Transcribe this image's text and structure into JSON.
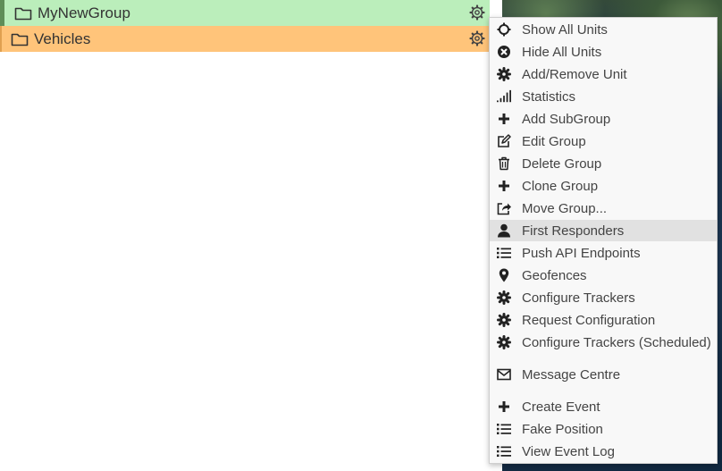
{
  "groups": [
    {
      "name": "MyNewGroup",
      "color": "#bbeebb"
    },
    {
      "name": "Vehicles",
      "color": "#ffc47a"
    }
  ],
  "context_menu": {
    "highlighted": "First Responders",
    "items": [
      {
        "label": "Show All Units",
        "icon": "crosshair-icon"
      },
      {
        "label": "Hide All Units",
        "icon": "circle-x-icon"
      },
      {
        "label": "Add/Remove Unit",
        "icon": "gear-icon"
      },
      {
        "label": "Statistics",
        "icon": "signal-bars-icon"
      },
      {
        "label": "Add SubGroup",
        "icon": "plus-icon"
      },
      {
        "label": "Edit Group",
        "icon": "edit-icon"
      },
      {
        "label": "Delete Group",
        "icon": "trash-icon"
      },
      {
        "label": "Clone Group",
        "icon": "plus-icon"
      },
      {
        "label": "Move Group...",
        "icon": "share-icon"
      },
      {
        "label": "First Responders",
        "icon": "user-icon"
      },
      {
        "label": "Push API Endpoints",
        "icon": "list-icon"
      },
      {
        "label": "Geofences",
        "icon": "map-marker-icon"
      },
      {
        "label": "Configure Trackers",
        "icon": "gear-icon"
      },
      {
        "label": "Request Configuration",
        "icon": "gear-icon"
      },
      {
        "label": "Configure Trackers (Scheduled)",
        "icon": "gear-icon"
      },
      {
        "label": "Message Centre",
        "icon": "envelope-icon"
      },
      {
        "label": "Create Event",
        "icon": "plus-icon"
      },
      {
        "label": "Fake Position",
        "icon": "list-icon"
      },
      {
        "label": "View Event Log",
        "icon": "list-icon"
      }
    ]
  }
}
